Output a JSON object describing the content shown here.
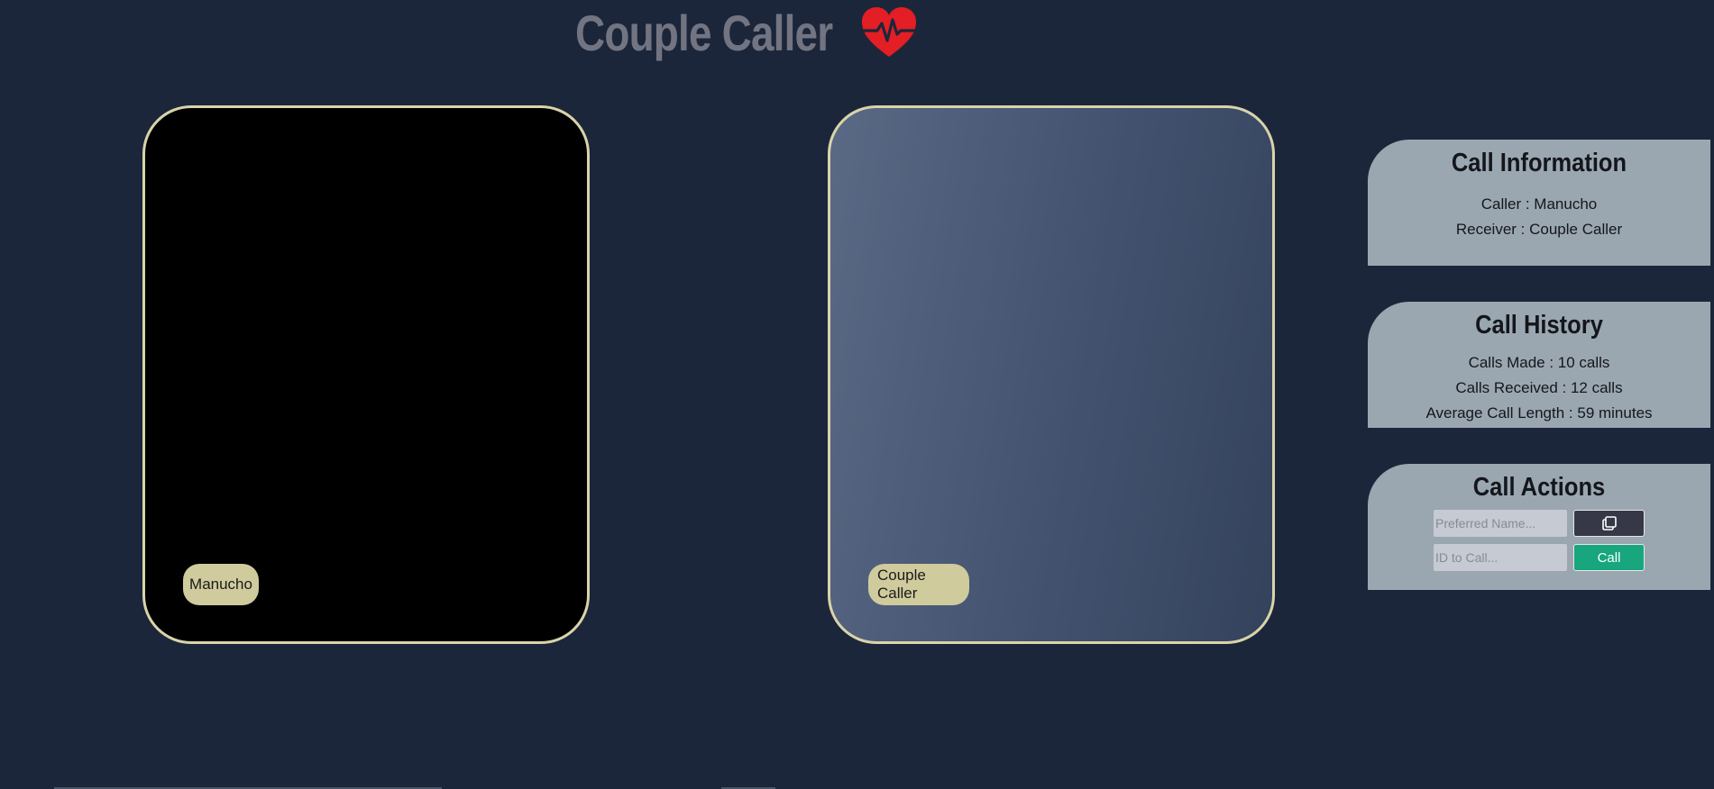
{
  "header": {
    "title": "Couple Caller",
    "icon": "heart-pulse-icon",
    "icon_color": "#e31e24"
  },
  "videos": {
    "local": {
      "name": "Manucho"
    },
    "remote": {
      "name": "Couple Caller"
    }
  },
  "call_information": {
    "title": "Call Information",
    "caller": "Caller : Manucho",
    "receiver": "Receiver : Couple Caller"
  },
  "call_history": {
    "title": "Call History",
    "calls_made": "Calls Made : 10 calls",
    "calls_received": "Calls Received : 12 calls",
    "average_length": "Average Call Length : 59 minutes"
  },
  "call_actions": {
    "title": "Call Actions",
    "name_input": {
      "value": "",
      "placeholder": "Preferred Name..."
    },
    "copy_button_icon": "copy-icon",
    "id_input": {
      "value": "",
      "placeholder": "ID to Call..."
    },
    "call_button_label": "Call"
  },
  "colors": {
    "background": "#1c263a",
    "panel_border": "#d9d4a9",
    "name_tag": "#d0cb9d",
    "card": "#9ba7b0",
    "call_button": "#17a67e",
    "copy_button": "#363847"
  }
}
